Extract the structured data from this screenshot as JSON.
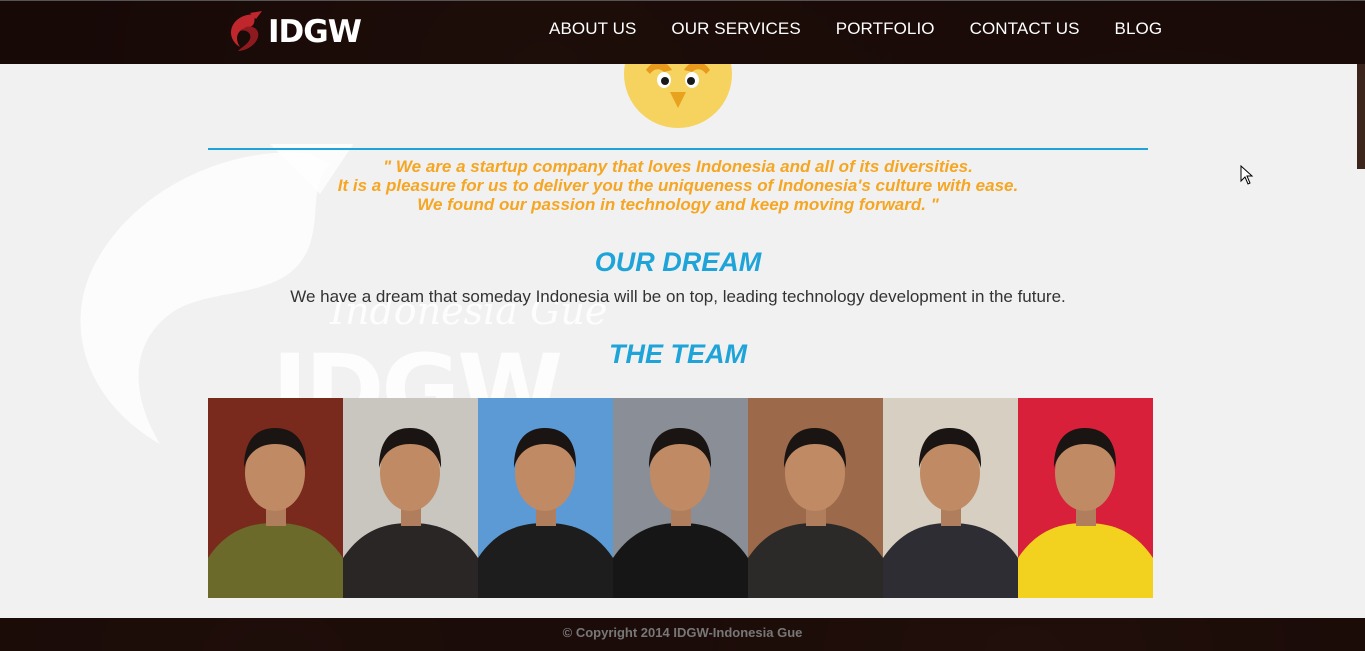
{
  "header": {
    "logo_text": "IDGW",
    "nav": [
      {
        "label": "ABOUT US"
      },
      {
        "label": "OUR SERVICES"
      },
      {
        "label": "PORTFOLIO"
      },
      {
        "label": "CONTACT US"
      },
      {
        "label": "BLOG"
      }
    ]
  },
  "watermark": {
    "script_text": "Indonesia Gue",
    "big_text": "IDGW"
  },
  "about": {
    "quote_lines": [
      "\" We are a startup company that loves Indonesia and all of its diversities.",
      "It is a pleasure for us to deliver you the uniqueness of Indonesia's culture with ease.",
      "We found our passion in technology and keep moving forward. \""
    ],
    "dream_heading": "OUR DREAM",
    "dream_text": "We have a dream that someday Indonesia will be on top, leading technology development in the future.",
    "team_heading": "THE TEAM"
  },
  "team": [
    {
      "bg": "#7a2a1c",
      "shirt": "#6b6a2a"
    },
    {
      "bg": "#c9c6c0",
      "shirt": "#2a2626"
    },
    {
      "bg": "#5c9ad6",
      "shirt": "#1d1d1d"
    },
    {
      "bg": "#8a8e96",
      "shirt": "#161616"
    },
    {
      "bg": "#9c6a4a",
      "shirt": "#2b2a28"
    },
    {
      "bg": "#d6cfc2",
      "shirt": "#2e2d33"
    },
    {
      "bg": "#d8203a",
      "shirt": "#f2d21e"
    }
  ],
  "footer": {
    "copyright": "© Copyright 2014 IDGW-Indonesia Gue"
  },
  "colors": {
    "accent_blue": "#1ea4d8",
    "quote_orange": "#f5a623",
    "logo_red": "#c0272d"
  }
}
